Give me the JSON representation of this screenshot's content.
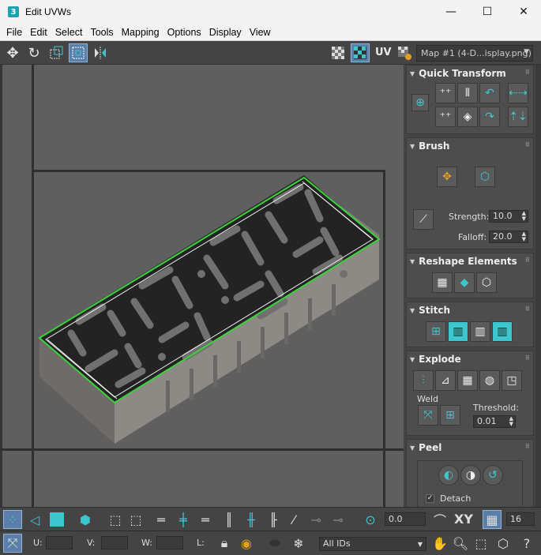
{
  "window": {
    "title": "Edit UVWs",
    "app_icon": "3",
    "minimize": "—",
    "maximize": "☐",
    "close": "✕"
  },
  "menu": [
    "File",
    "Edit",
    "Select",
    "Tools",
    "Mapping",
    "Options",
    "Display",
    "View"
  ],
  "toolbar": {
    "uv_label": "UV",
    "map_select": "Map #1 (4-D...isplay.png)"
  },
  "panel": {
    "quick_transform": {
      "title": "Quick Transform"
    },
    "brush": {
      "title": "Brush",
      "strength_label": "Strength:",
      "strength_value": "10.0",
      "falloff_label": "Falloff:",
      "falloff_value": "20.0"
    },
    "reshape": {
      "title": "Reshape Elements"
    },
    "stitch": {
      "title": "Stitch"
    },
    "explode": {
      "title": "Explode",
      "weld_label": "Weld",
      "threshold_label": "Threshold:",
      "threshold_value": "0.01"
    },
    "peel": {
      "title": "Peel",
      "detach_label": "Detach",
      "detach_checked": true
    }
  },
  "bottom": {
    "rotation_value": "0.0",
    "xy_label": "XY",
    "grid_value": "16",
    "u_label": "U:",
    "v_label": "V:",
    "w_label": "W:",
    "l_label": "L:",
    "ids_select": "All IDs"
  },
  "colors": {
    "accent_teal": "#3cc7cf",
    "active_blue": "#5b7fa8",
    "uv_outline": "#3cd23c"
  }
}
